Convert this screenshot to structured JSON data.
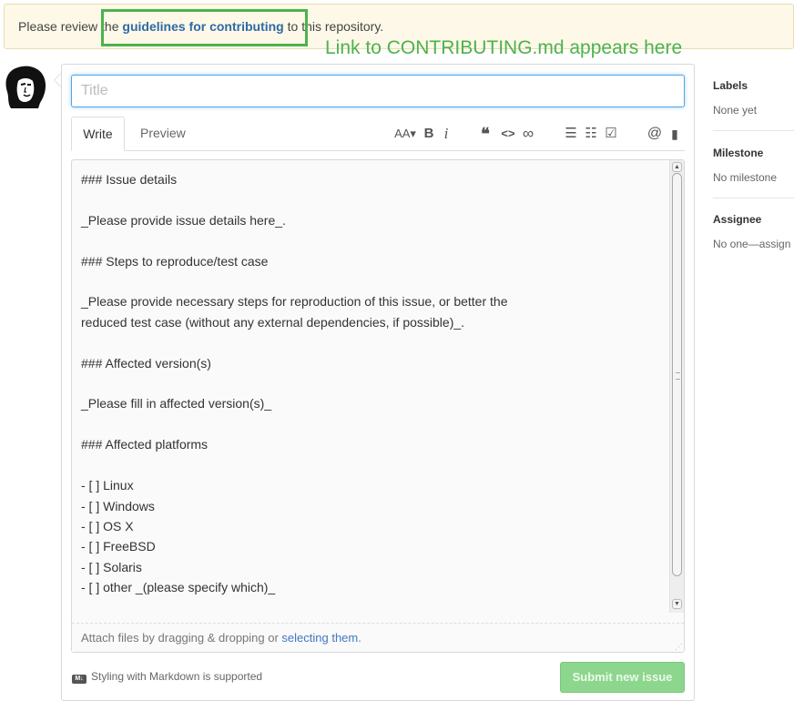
{
  "banner": {
    "prefix": "Please review the ",
    "link_text": "guidelines for contributing",
    "suffix": " to this repository."
  },
  "annotation": "Link to CONTRIBUTING.md appears here",
  "annotation_color": "#4db24d",
  "title_input": {
    "placeholder": "Title",
    "value": ""
  },
  "tabs": {
    "write": "Write",
    "preview": "Preview"
  },
  "toolbar": {
    "text_size": "AA▾",
    "bold": "B",
    "italic": "i",
    "quote": "❝",
    "code": "<>",
    "link": "∞",
    "bullet_list": "☰",
    "numbered_list": "☷",
    "task_list": "☑",
    "mention": "@",
    "saved_reply": "▮"
  },
  "editor": {
    "body": "### Issue details\n\n_Please provide issue details here_.\n\n### Steps to reproduce/test case\n\n_Please provide necessary steps for reproduction of this issue, or better the\nreduced test case (without any external dependencies, if possible)_.\n\n### Affected version(s)\n\n_Please fill in affected version(s)_\n\n### Affected platforms\n\n- [ ] Linux\n- [ ] Windows\n- [ ] OS X\n- [ ] FreeBSD\n- [ ] Solaris\n- [ ] other _(please specify which)_",
    "attach_prefix": "Attach files by dragging & dropping or ",
    "attach_link": "selecting them",
    "attach_suffix": "."
  },
  "footer": {
    "markdown_icon": "M↓",
    "markdown_note": "Styling with Markdown is supported",
    "submit_label": "Submit new issue"
  },
  "sidebar": {
    "labels": {
      "heading": "Labels",
      "value": "None yet"
    },
    "milestone": {
      "heading": "Milestone",
      "value": "No milestone"
    },
    "assignee": {
      "heading": "Assignee",
      "value": "No one—assign yourself"
    }
  }
}
